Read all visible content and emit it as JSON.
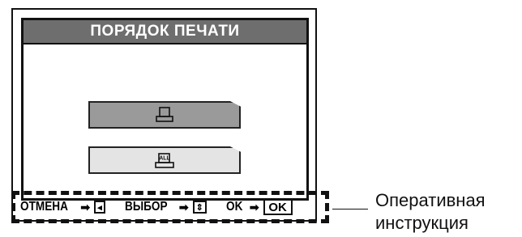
{
  "screen": {
    "title": "ПОРЯДОК ПЕЧАТИ",
    "options": [
      {
        "icon": "single-print-icon",
        "state": "selected"
      },
      {
        "icon": "all-print-icon",
        "icon_text": "ALL",
        "state": "normal"
      }
    ]
  },
  "guide": {
    "cancel_label": "ОТМЕНА",
    "cancel_key_icon": "left-arrow-key-icon",
    "select_label": "ВЫБОР",
    "select_key_icon": "up-down-key-icon",
    "ok_label": "OK",
    "ok_key": "OK",
    "arrow": "➡"
  },
  "callout": {
    "line1": "Оперативная",
    "line2": "инструкция"
  },
  "colors": {
    "title_bg": "#6e6e6e",
    "selected_bg": "#9a9a9a",
    "normal_bg": "#e4e4e4"
  }
}
